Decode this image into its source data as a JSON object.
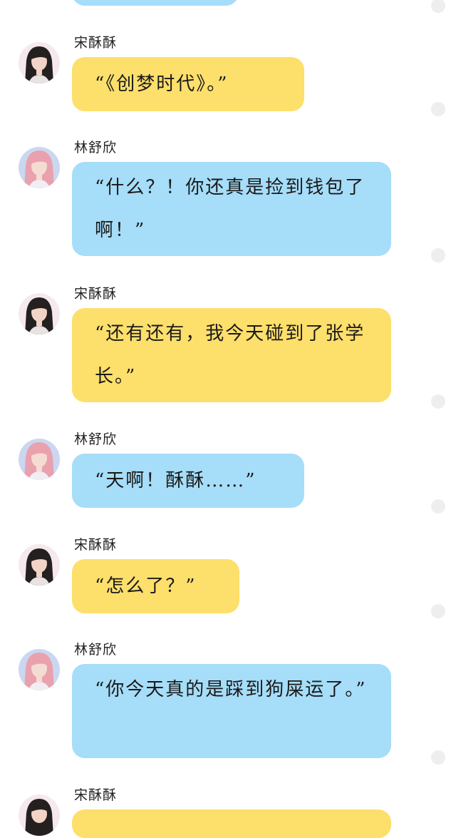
{
  "colors": {
    "yellow_bubble": "#fddf6b",
    "blue_bubble": "#a6ddf8",
    "background": "#ffffff",
    "side_dot": "#eeeeee"
  },
  "messages": [
    {
      "speaker": "宋酥酥",
      "avatar": "avatar-song",
      "bubble_color": "yellow",
      "text": "“《创梦时代》。”"
    },
    {
      "speaker": "林舒欣",
      "avatar": "avatar-lin",
      "bubble_color": "blue",
      "text": "“什么？！你还真是捡到钱包了啊！”"
    },
    {
      "speaker": "宋酥酥",
      "avatar": "avatar-song",
      "bubble_color": "yellow",
      "text": "“还有还有，我今天碰到了张学长。”"
    },
    {
      "speaker": "林舒欣",
      "avatar": "avatar-lin",
      "bubble_color": "blue",
      "text": "“天啊！酥酥……”"
    },
    {
      "speaker": "宋酥酥",
      "avatar": "avatar-song",
      "bubble_color": "yellow",
      "text": "“怎么了？”"
    },
    {
      "speaker": "林舒欣",
      "avatar": "avatar-lin",
      "bubble_color": "blue",
      "text": "“你今天真的是踩到狗屎运了。”"
    },
    {
      "speaker": "宋酥酥",
      "avatar": "avatar-song",
      "bubble_color": "yellow",
      "text": ""
    }
  ]
}
